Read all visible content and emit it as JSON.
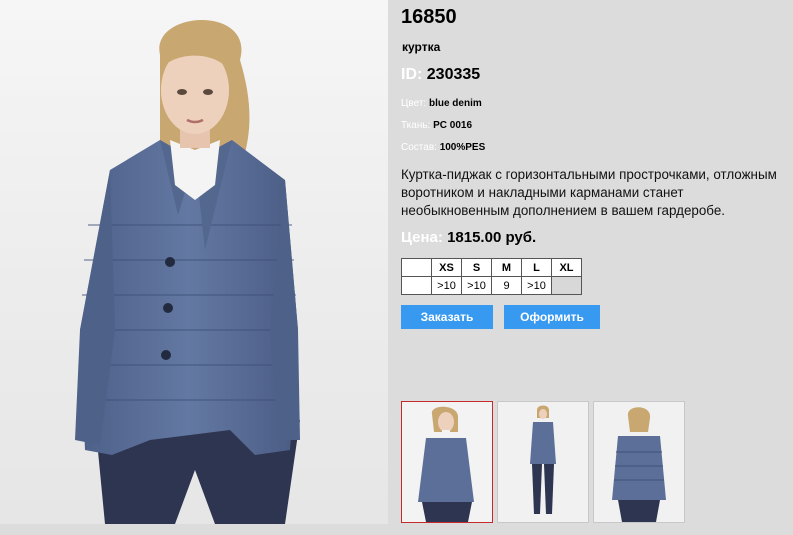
{
  "product": {
    "sku": "16850",
    "type": "куртка",
    "id_label": "ID:",
    "id_value": "230335",
    "color_label": "Цвет:",
    "color_value": "blue denim",
    "fabric_label": "Ткань:",
    "fabric_value": "PC 0016",
    "composition_label": "Состав:",
    "composition_value": "100%PES",
    "description": "Куртка-пиджак с горизонтальными прострочками, отложным воротником и накладными карманами станет необыкновенным дополнением в вашем гардеробе.",
    "price_label": "Цена:",
    "price_value": "1815.00 руб."
  },
  "sizes": {
    "headers": [
      "XS",
      "S",
      "M",
      "L",
      "XL"
    ],
    "stock": [
      ">10",
      ">10",
      "9",
      ">10",
      ""
    ]
  },
  "buttons": {
    "order": "Заказать",
    "checkout": "Оформить"
  },
  "colors": {
    "accent_button": "#3799f0",
    "selected_thumb_border": "#c52a2a",
    "background": "#dcdcdc",
    "jacket": "#5b6f98"
  },
  "thumbnails": [
    {
      "icon": "front-closeup-photo",
      "selected": true
    },
    {
      "icon": "full-length-photo",
      "selected": false
    },
    {
      "icon": "back-view-photo",
      "selected": false
    }
  ]
}
